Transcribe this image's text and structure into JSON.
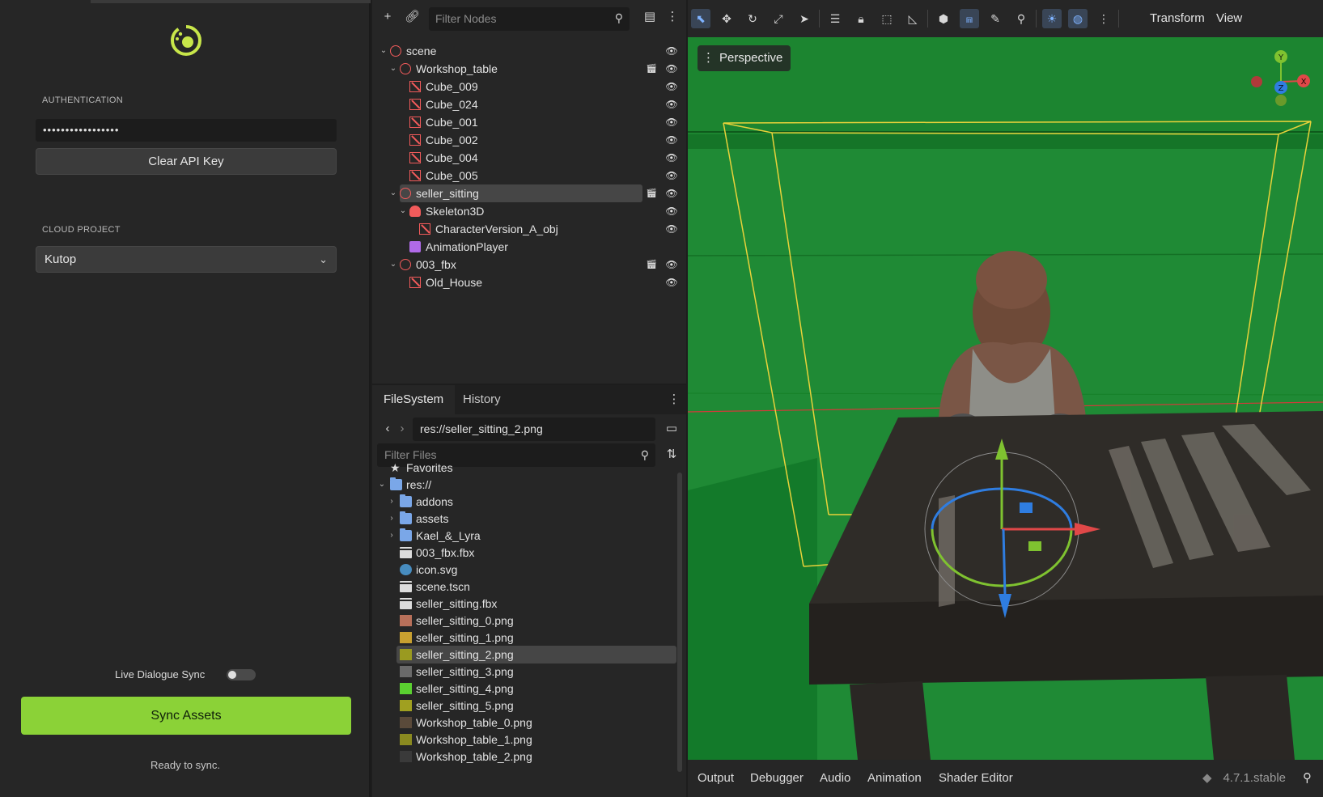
{
  "plugin": {
    "auth_label": "AUTHENTICATION",
    "api_key_masked": "•••••••••••••••••",
    "clear_button": "Clear API Key",
    "project_label": "CLOUD PROJECT",
    "project_value": "Kutop",
    "live_sync_label": "Live Dialogue Sync",
    "live_sync_on": false,
    "sync_button": "Sync Assets",
    "status": "Ready to sync.",
    "accent_color": "#8bd237"
  },
  "scene_dock": {
    "filter_placeholder": "Filter Nodes",
    "nodes": [
      {
        "label": "scene",
        "icon": "node3d-icon",
        "arrow": "down",
        "eye": true,
        "clap": false
      },
      {
        "label": "Workshop_table",
        "icon": "node3d-icon",
        "arrow": "down",
        "eye": true,
        "clap": true
      },
      {
        "label": "Cube_009",
        "icon": "mesh-icon",
        "arrow": "",
        "eye": true,
        "clap": false
      },
      {
        "label": "Cube_024",
        "icon": "mesh-icon",
        "arrow": "",
        "eye": true,
        "clap": false
      },
      {
        "label": "Cube_001",
        "icon": "mesh-icon",
        "arrow": "",
        "eye": true,
        "clap": false
      },
      {
        "label": "Cube_002",
        "icon": "mesh-icon",
        "arrow": "",
        "eye": true,
        "clap": false
      },
      {
        "label": "Cube_004",
        "icon": "mesh-icon",
        "arrow": "",
        "eye": true,
        "clap": false
      },
      {
        "label": "Cube_005",
        "icon": "mesh-icon",
        "arrow": "",
        "eye": true,
        "clap": false
      },
      {
        "label": "seller_sitting",
        "icon": "node3d-icon",
        "arrow": "down",
        "eye": true,
        "clap": true,
        "selected": true
      },
      {
        "label": "Skeleton3D",
        "icon": "skeleton-icon",
        "arrow": "down",
        "eye": true,
        "clap": false
      },
      {
        "label": "CharacterVersion_A_obj",
        "icon": "mesh-icon",
        "arrow": "",
        "eye": true,
        "clap": false
      },
      {
        "label": "AnimationPlayer",
        "icon": "animation-player-icon",
        "arrow": "",
        "eye": false,
        "clap": false
      },
      {
        "label": "003_fbx",
        "icon": "node3d-icon",
        "arrow": "down",
        "eye": true,
        "clap": true
      },
      {
        "label": "Old_House",
        "icon": "mesh-icon",
        "arrow": "",
        "eye": true,
        "clap": false
      }
    ]
  },
  "filesystem": {
    "tabs": [
      "FileSystem",
      "History"
    ],
    "path": "res://seller_sitting_2.png",
    "filter_placeholder": "Filter Files",
    "items": [
      {
        "label": "Favorites",
        "icon": "star-icon"
      },
      {
        "label": "res://",
        "icon": "folder-icon",
        "arrow": "down"
      },
      {
        "label": "addons",
        "icon": "folder-icon",
        "arrow": "right"
      },
      {
        "label": "assets",
        "icon": "folder-icon",
        "arrow": "right"
      },
      {
        "label": "Kael_&_Lyra",
        "icon": "folder-icon",
        "arrow": "right"
      },
      {
        "label": "003_fbx.fbx",
        "icon": "scene-file-icon"
      },
      {
        "label": "icon.svg",
        "icon": "godot-icon"
      },
      {
        "label": "scene.tscn",
        "icon": "scene-file-icon"
      },
      {
        "label": "seller_sitting.fbx",
        "icon": "scene-file-icon"
      },
      {
        "label": "seller_sitting_0.png",
        "icon": "texture-thumb-icon",
        "color": "#b8705a"
      },
      {
        "label": "seller_sitting_1.png",
        "icon": "texture-thumb-icon",
        "color": "#c8a030"
      },
      {
        "label": "seller_sitting_2.png",
        "icon": "texture-thumb-icon",
        "color": "#9a9a20",
        "selected": true
      },
      {
        "label": "seller_sitting_3.png",
        "icon": "texture-thumb-icon",
        "color": "#6a6a6a"
      },
      {
        "label": "seller_sitting_4.png",
        "icon": "texture-thumb-icon",
        "color": "#5ad030"
      },
      {
        "label": "seller_sitting_5.png",
        "icon": "texture-thumb-icon",
        "color": "#a0a020"
      },
      {
        "label": "Workshop_table_0.png",
        "icon": "texture-thumb-icon",
        "color": "#5a4a3a"
      },
      {
        "label": "Workshop_table_1.png",
        "icon": "texture-thumb-icon",
        "color": "#8a8a20"
      },
      {
        "label": "Workshop_table_2.png",
        "icon": "texture-thumb-icon",
        "color": "#3a3a3a"
      }
    ]
  },
  "viewport": {
    "menu_transform": "Transform",
    "menu_view": "View",
    "perspective_label": "Perspective",
    "axis_labels": {
      "x": "X",
      "y": "Y",
      "z": "Z"
    },
    "background_color": "#1f8a35"
  },
  "bottom": {
    "tabs": [
      "Output",
      "Debugger",
      "Audio",
      "Animation",
      "Shader Editor"
    ],
    "version": "4.7.1.stable"
  }
}
